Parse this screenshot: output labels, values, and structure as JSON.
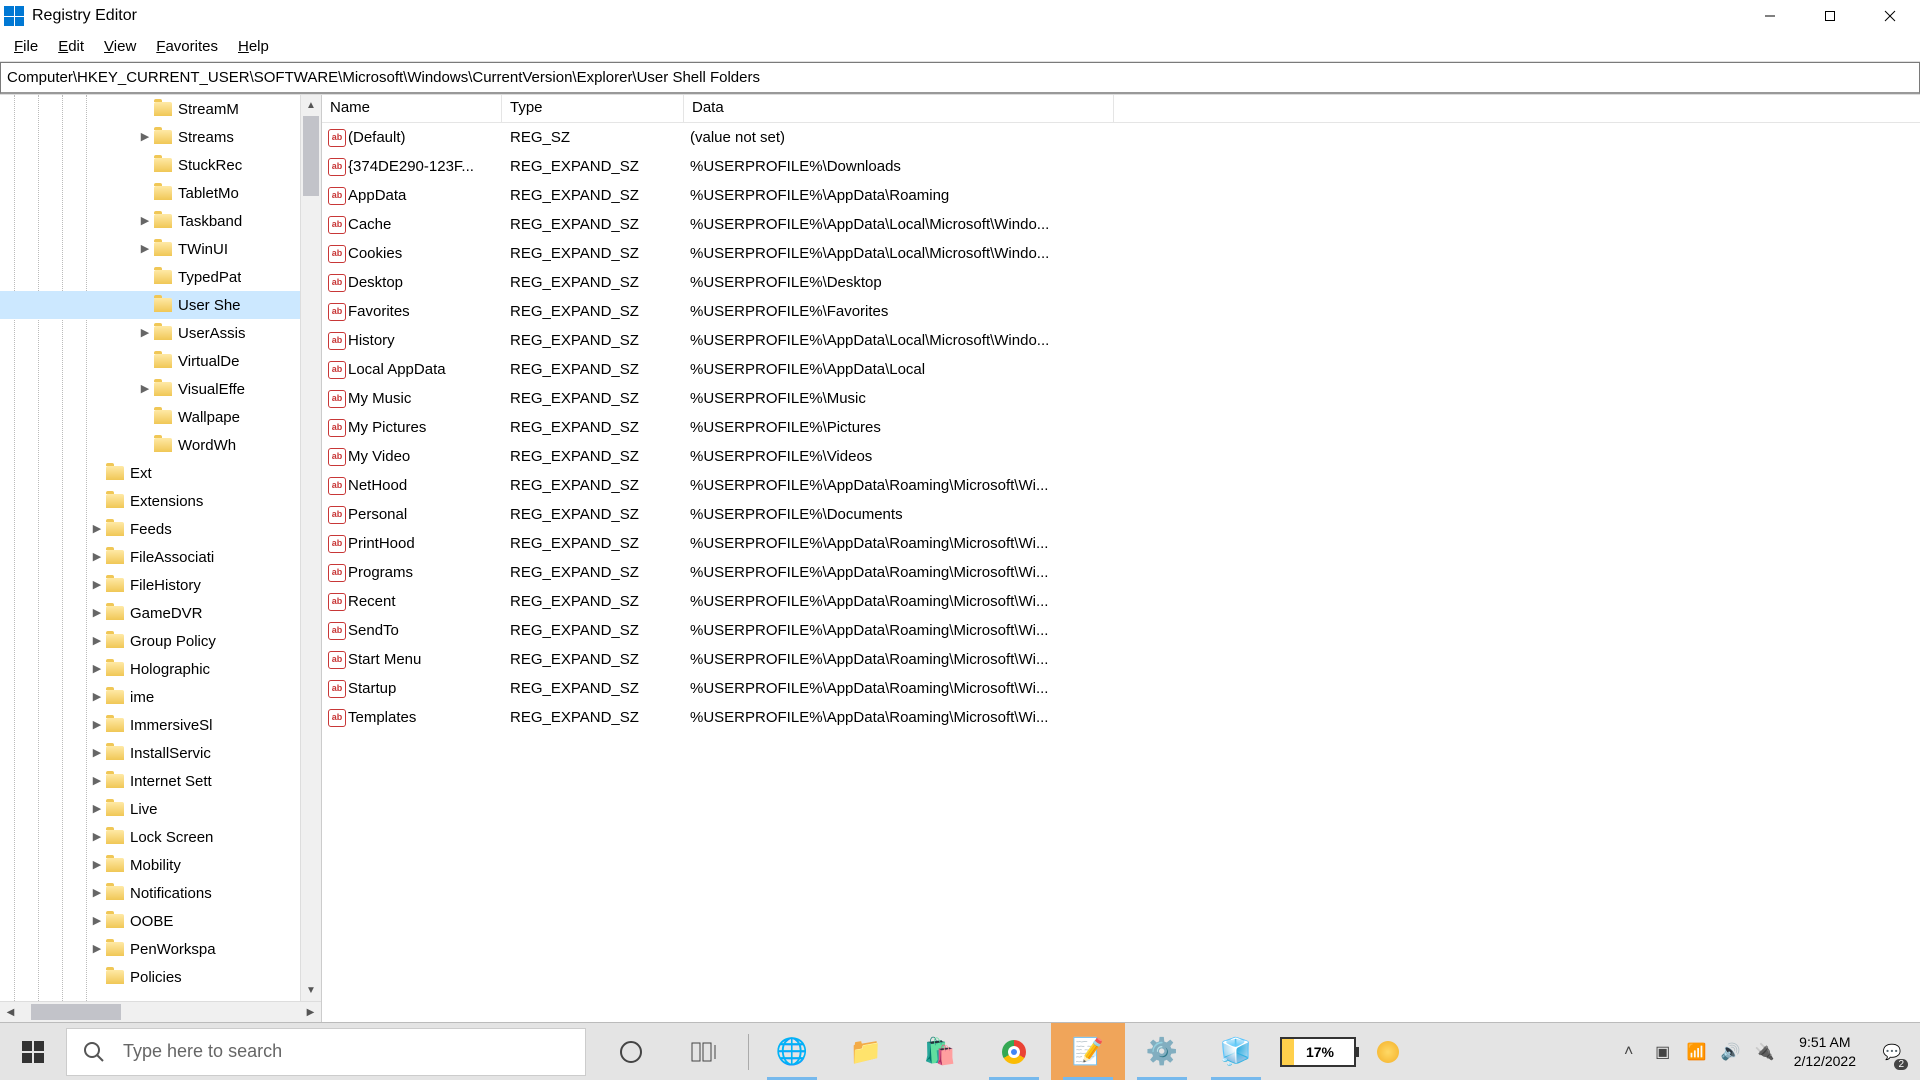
{
  "window_title": "Registry Editor",
  "menu": [
    "File",
    "Edit",
    "View",
    "Favorites",
    "Help"
  ],
  "address": "Computer\\HKEY_CURRENT_USER\\SOFTWARE\\Microsoft\\Windows\\CurrentVersion\\Explorer\\User Shell Folders",
  "tree": [
    {
      "label": "StreamM",
      "indent": 4,
      "exp": ""
    },
    {
      "label": "Streams",
      "indent": 4,
      "exp": ">"
    },
    {
      "label": "StuckRec",
      "indent": 4,
      "exp": ""
    },
    {
      "label": "TabletMo",
      "indent": 4,
      "exp": ""
    },
    {
      "label": "Taskband",
      "indent": 4,
      "exp": ">"
    },
    {
      "label": "TWinUI",
      "indent": 4,
      "exp": ">"
    },
    {
      "label": "TypedPat",
      "indent": 4,
      "exp": ""
    },
    {
      "label": "User She",
      "indent": 4,
      "exp": "",
      "selected": true
    },
    {
      "label": "UserAssis",
      "indent": 4,
      "exp": ">"
    },
    {
      "label": "VirtualDe",
      "indent": 4,
      "exp": ""
    },
    {
      "label": "VisualEffe",
      "indent": 4,
      "exp": ">"
    },
    {
      "label": "Wallpape",
      "indent": 4,
      "exp": ""
    },
    {
      "label": "WordWh",
      "indent": 4,
      "exp": ""
    },
    {
      "label": "Ext",
      "indent": 3,
      "exp": ""
    },
    {
      "label": "Extensions",
      "indent": 3,
      "exp": ""
    },
    {
      "label": "Feeds",
      "indent": 3,
      "exp": ">"
    },
    {
      "label": "FileAssociati",
      "indent": 3,
      "exp": ">"
    },
    {
      "label": "FileHistory",
      "indent": 3,
      "exp": ">"
    },
    {
      "label": "GameDVR",
      "indent": 3,
      "exp": ">"
    },
    {
      "label": "Group Policy",
      "indent": 3,
      "exp": ">"
    },
    {
      "label": "Holographic",
      "indent": 3,
      "exp": ">"
    },
    {
      "label": "ime",
      "indent": 3,
      "exp": ">"
    },
    {
      "label": "ImmersiveSl",
      "indent": 3,
      "exp": ">"
    },
    {
      "label": "InstallServic",
      "indent": 3,
      "exp": ">"
    },
    {
      "label": "Internet Sett",
      "indent": 3,
      "exp": ">"
    },
    {
      "label": "Live",
      "indent": 3,
      "exp": ">"
    },
    {
      "label": "Lock Screen",
      "indent": 3,
      "exp": ">"
    },
    {
      "label": "Mobility",
      "indent": 3,
      "exp": ">"
    },
    {
      "label": "Notifications",
      "indent": 3,
      "exp": ">"
    },
    {
      "label": "OOBE",
      "indent": 3,
      "exp": ">"
    },
    {
      "label": "PenWorkspa",
      "indent": 3,
      "exp": ">"
    },
    {
      "label": "Policies",
      "indent": 3,
      "exp": ""
    }
  ],
  "columns": {
    "name": "Name",
    "type": "Type",
    "data": "Data"
  },
  "rows": [
    {
      "name": "(Default)",
      "type": "REG_SZ",
      "data": "(value not set)"
    },
    {
      "name": "{374DE290-123F...",
      "type": "REG_EXPAND_SZ",
      "data": "%USERPROFILE%\\Downloads"
    },
    {
      "name": "AppData",
      "type": "REG_EXPAND_SZ",
      "data": "%USERPROFILE%\\AppData\\Roaming"
    },
    {
      "name": "Cache",
      "type": "REG_EXPAND_SZ",
      "data": "%USERPROFILE%\\AppData\\Local\\Microsoft\\Windo..."
    },
    {
      "name": "Cookies",
      "type": "REG_EXPAND_SZ",
      "data": "%USERPROFILE%\\AppData\\Local\\Microsoft\\Windo..."
    },
    {
      "name": "Desktop",
      "type": "REG_EXPAND_SZ",
      "data": "%USERPROFILE%\\Desktop"
    },
    {
      "name": "Favorites",
      "type": "REG_EXPAND_SZ",
      "data": "%USERPROFILE%\\Favorites"
    },
    {
      "name": "History",
      "type": "REG_EXPAND_SZ",
      "data": "%USERPROFILE%\\AppData\\Local\\Microsoft\\Windo..."
    },
    {
      "name": "Local AppData",
      "type": "REG_EXPAND_SZ",
      "data": "%USERPROFILE%\\AppData\\Local"
    },
    {
      "name": "My Music",
      "type": "REG_EXPAND_SZ",
      "data": "%USERPROFILE%\\Music"
    },
    {
      "name": "My Pictures",
      "type": "REG_EXPAND_SZ",
      "data": "%USERPROFILE%\\Pictures"
    },
    {
      "name": "My Video",
      "type": "REG_EXPAND_SZ",
      "data": "%USERPROFILE%\\Videos"
    },
    {
      "name": "NetHood",
      "type": "REG_EXPAND_SZ",
      "data": "%USERPROFILE%\\AppData\\Roaming\\Microsoft\\Wi..."
    },
    {
      "name": "Personal",
      "type": "REG_EXPAND_SZ",
      "data": "%USERPROFILE%\\Documents"
    },
    {
      "name": "PrintHood",
      "type": "REG_EXPAND_SZ",
      "data": "%USERPROFILE%\\AppData\\Roaming\\Microsoft\\Wi..."
    },
    {
      "name": "Programs",
      "type": "REG_EXPAND_SZ",
      "data": "%USERPROFILE%\\AppData\\Roaming\\Microsoft\\Wi..."
    },
    {
      "name": "Recent",
      "type": "REG_EXPAND_SZ",
      "data": "%USERPROFILE%\\AppData\\Roaming\\Microsoft\\Wi..."
    },
    {
      "name": "SendTo",
      "type": "REG_EXPAND_SZ",
      "data": "%USERPROFILE%\\AppData\\Roaming\\Microsoft\\Wi..."
    },
    {
      "name": "Start Menu",
      "type": "REG_EXPAND_SZ",
      "data": "%USERPROFILE%\\AppData\\Roaming\\Microsoft\\Wi..."
    },
    {
      "name": "Startup",
      "type": "REG_EXPAND_SZ",
      "data": "%USERPROFILE%\\AppData\\Roaming\\Microsoft\\Wi..."
    },
    {
      "name": "Templates",
      "type": "REG_EXPAND_SZ",
      "data": "%USERPROFILE%\\AppData\\Roaming\\Microsoft\\Wi..."
    }
  ],
  "taskbar": {
    "search_placeholder": "Type here to search",
    "battery": "17%",
    "time": "9:51 AM",
    "date": "2/12/2022",
    "notif_count": "2"
  }
}
